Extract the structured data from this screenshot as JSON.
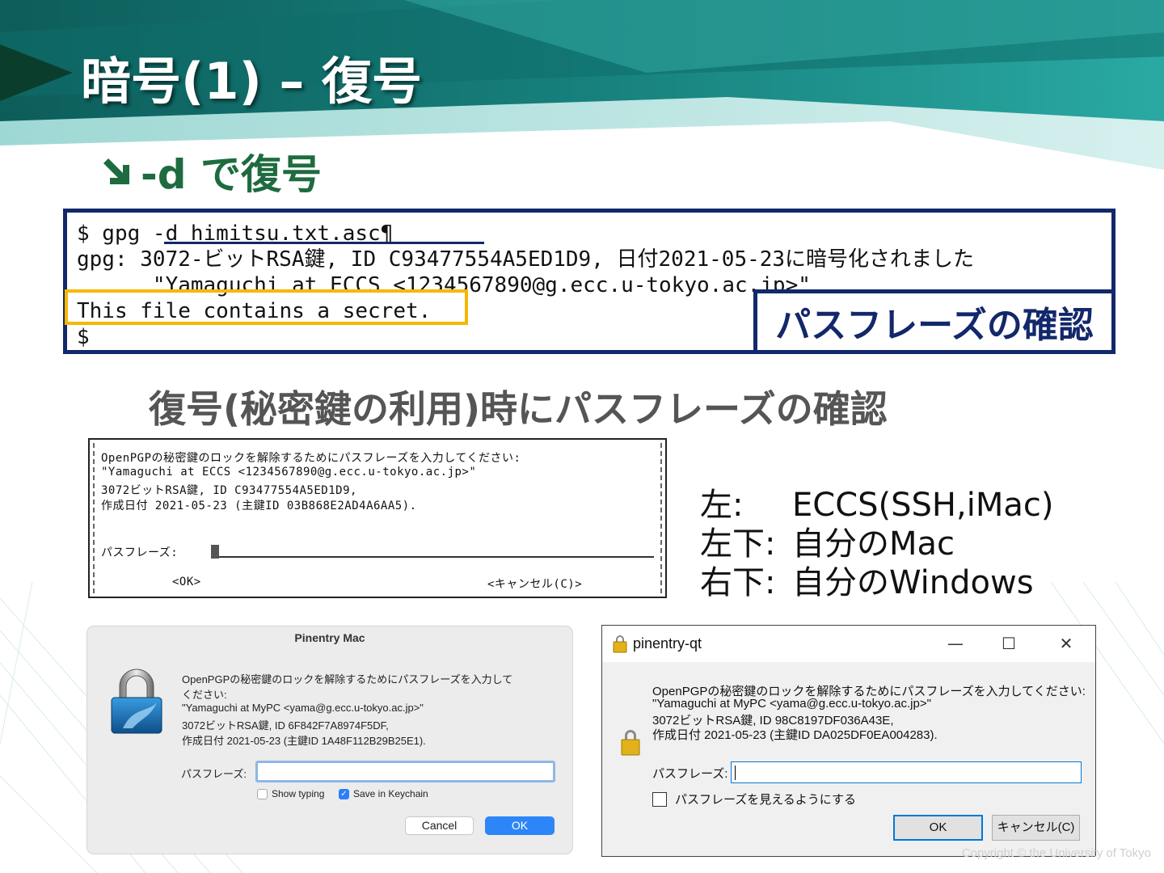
{
  "slide": {
    "title": "暗号(1) – 復号",
    "subtitle": "-d で復号",
    "heading2": "復号(秘密鍵の利用)時にパスフレーズの確認",
    "passphrase_callout": "パスフレーズの確認",
    "copyright": "Copyright © the University of Tokyo"
  },
  "terminal": {
    "lines": [
      "$ gpg -d himitsu.txt.asc¶",
      "gpg: 3072-ビットRSA鍵, ID C93477554A5ED1D9, 日付2021-05-23に暗号化されました",
      "      \"Yamaguchi at ECCS <1234567890@g.ecc.u-tokyo.ac.jp>\"",
      "This file contains a secret.",
      "$"
    ]
  },
  "curses_dialog": {
    "lines": [
      "OpenPGPの秘密鍵のロックを解除するためにパスフレーズを入力してください:",
      "\"Yamaguchi at ECCS <1234567890@g.ecc.u-tokyo.ac.jp>\"",
      "3072ビットRSA鍵, ID C93477554A5ED1D9,",
      "作成日付 2021-05-23 (主鍵ID 03B868E2AD4A6AA5)."
    ],
    "pass_label": "パスフレーズ:",
    "ok": "<OK>",
    "cancel": "<キャンセル(C)>"
  },
  "info": {
    "rows": [
      {
        "label": "左:",
        "value": "ECCS(SSH,iMac)"
      },
      {
        "label": "左下:",
        "value": "自分のMac"
      },
      {
        "label": "右下:",
        "value": "自分のWindows"
      }
    ]
  },
  "mac_dialog": {
    "title": "Pinentry Mac",
    "lines": [
      "OpenPGPの秘密鍵のロックを解除するためにパスフレーズを入力して",
      "ください:",
      "\"Yamaguchi at MyPC <yama@g.ecc.u-tokyo.ac.jp>\"",
      "3072ビットRSA鍵, ID 6F842F7A8974F5DF,",
      "作成日付 2021-05-23 (主鍵ID 1A48F112B29B25E1)."
    ],
    "pass_label": "パスフレーズ:",
    "show_typing": "Show typing",
    "save_keychain": "Save in Keychain",
    "cancel": "Cancel",
    "ok": "OK"
  },
  "win_dialog": {
    "title": "pinentry-qt",
    "lines": [
      "OpenPGPの秘密鍵のロックを解除するためにパスフレーズを入力してください:",
      "\"Yamaguchi at MyPC <yama@g.ecc.u-tokyo.ac.jp>\"",
      "3072ビットRSA鍵, ID 98C8197DF036A43E,",
      "作成日付 2021-05-23 (主鍵ID DA025DF0EA004283)."
    ],
    "pass_label": "パスフレーズ:",
    "show_pass": "パスフレーズを見えるようにする",
    "ok": "OK",
    "cancel": "キャンセル(C)",
    "minimize": "—",
    "maximize": "☐",
    "close": "✕"
  },
  "colors": {
    "accent_green": "#1e6b3f",
    "navy": "#13286b",
    "highlight": "#f5b800",
    "mac_blue": "#2d86f7",
    "win_blue": "#0078d7"
  }
}
